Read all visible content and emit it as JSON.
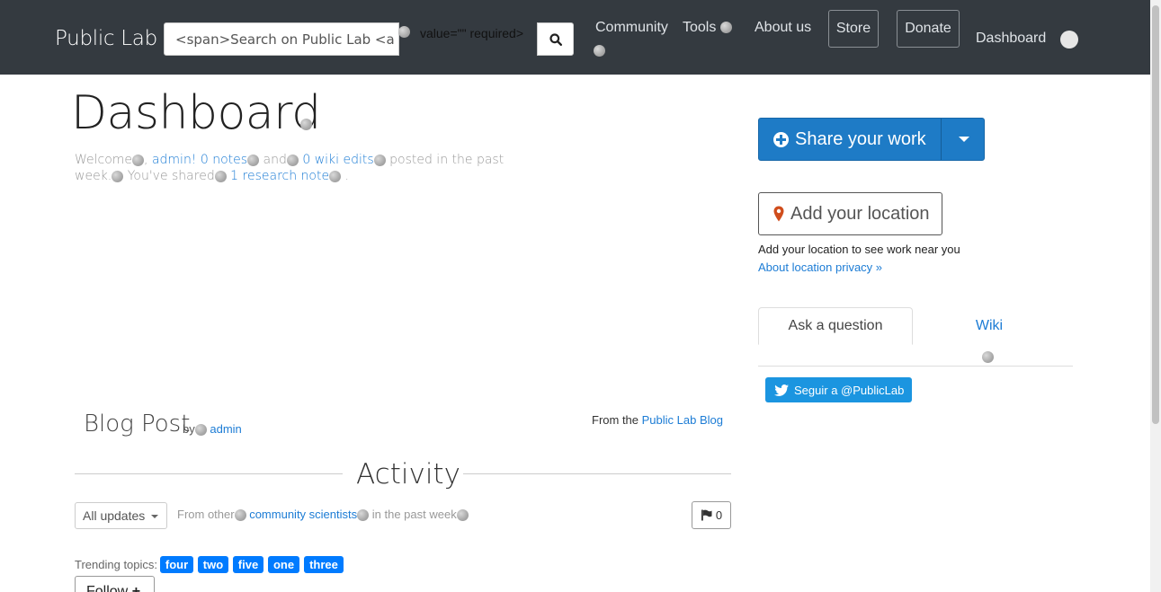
{
  "navbar": {
    "brand": "Public Lab",
    "search_value": "<span>Search on Public Lab <a class",
    "leaked_markup": "value=\"\" required>",
    "links": {
      "community": "Community",
      "tools": "Tools",
      "about": "About us",
      "store": "Store",
      "donate": "Donate",
      "dashboard": "Dashboard"
    },
    "bg_color": "#343a40"
  },
  "page": {
    "title": "Dashboard",
    "welcome": {
      "welcome": "Welcome",
      "sep1": ", ",
      "admin_link": "admin!",
      "notes_link": "0 notes",
      "and": "and",
      "wiki_link": "0 wiki edits",
      "posted": "posted in the past week.",
      "shared": "You've shared",
      "research_link": "1 research note",
      "end": "."
    }
  },
  "blog": {
    "title": "Blog Post",
    "by": "by",
    "author": "admin",
    "from_prefix": "From the",
    "from_link": "Public Lab Blog"
  },
  "activity": {
    "heading": "Activity",
    "filter_value": "All updates",
    "from_other": "From other",
    "community_link": "community scientists",
    "in_past_week": "in the past week",
    "flag_count": "0",
    "trending_label": "Trending topics:",
    "tags": [
      "four",
      "two",
      "five",
      "one",
      "three"
    ],
    "follow_label": "Follow"
  },
  "sidebar": {
    "share_label": "Share your work",
    "location_label": "Add your location",
    "location_text": "Add your location to see work near you",
    "privacy_link": "About location privacy »",
    "tabs": [
      "Ask a question",
      "Wiki"
    ],
    "twitter_label": "Seguir a @PublicLab"
  },
  "colors": {
    "primary": "#1e7bc6",
    "link": "#1c7cd5",
    "tag": "#007bff",
    "twitter": "#1b95e0",
    "location_pin": "#d04d1c"
  }
}
